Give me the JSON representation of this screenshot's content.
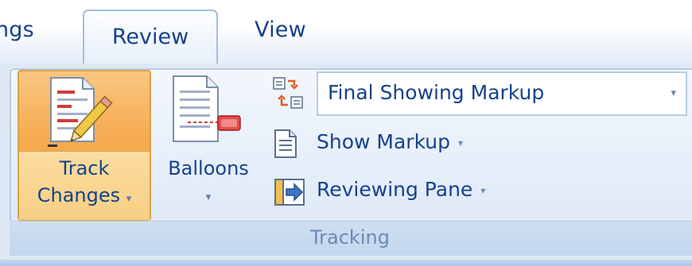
{
  "tabs": {
    "partial": "ngs",
    "review": "Review",
    "view": "View"
  },
  "group": {
    "label": "Tracking"
  },
  "track_changes": {
    "line1": "Track",
    "line2": "Changes",
    "arrow": "▾"
  },
  "balloons": {
    "label": "Balloons",
    "arrow": "▾"
  },
  "display_for_review": {
    "value": "Final Showing Markup",
    "arrow": "▾"
  },
  "show_markup": {
    "label": "Show Markup",
    "arrow": "▾"
  },
  "reviewing_pane": {
    "label": "Reviewing Pane",
    "arrow": "▾"
  },
  "colors": {
    "accent_text": "#15428b",
    "active_button": "#f6ad55",
    "group_label": "#6b8ab3"
  }
}
